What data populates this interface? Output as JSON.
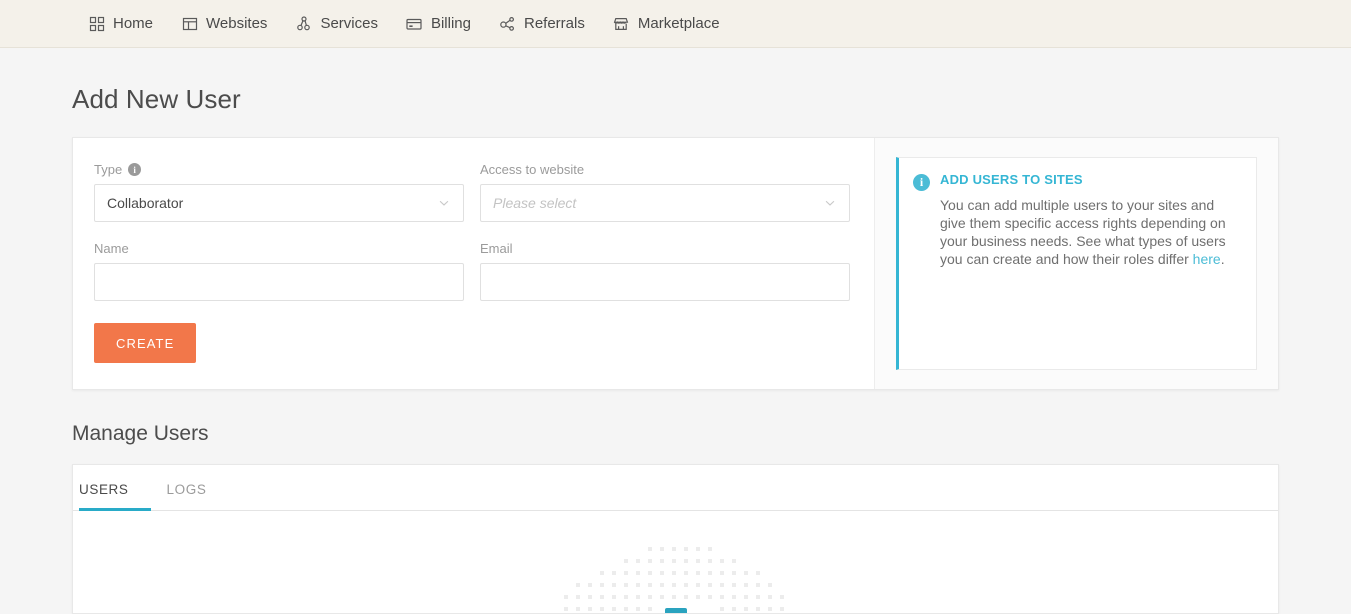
{
  "topnav": {
    "items": [
      {
        "label": "Home",
        "icon": "grid-icon"
      },
      {
        "label": "Websites",
        "icon": "browser-window-icon"
      },
      {
        "label": "Services",
        "icon": "nodes-network-icon"
      },
      {
        "label": "Billing",
        "icon": "credit-card-icon"
      },
      {
        "label": "Referrals",
        "icon": "share-nodes-icon"
      },
      {
        "label": "Marketplace",
        "icon": "storefront-icon"
      }
    ]
  },
  "page": {
    "title": "Add New User",
    "section_title": "Manage Users"
  },
  "form": {
    "type": {
      "label": "Type",
      "value": "Collaborator",
      "info_glyph": "i"
    },
    "access": {
      "label": "Access to website",
      "placeholder": "Please select",
      "value": ""
    },
    "name": {
      "label": "Name",
      "value": "",
      "placeholder": ""
    },
    "email": {
      "label": "Email",
      "value": "",
      "placeholder": ""
    },
    "submit_label": "CREATE"
  },
  "infobox": {
    "icon_glyph": "i",
    "title": "ADD USERS TO SITES",
    "body_before_link": "You can add multiple users to your sites and give them specific access rights depending on your business needs. See what types of users you can create and how their roles differ ",
    "link_text": "here",
    "body_after_link": "."
  },
  "tabs": [
    {
      "label": "USERS",
      "active": true
    },
    {
      "label": "LOGS",
      "active": false
    }
  ],
  "colors": {
    "accent_teal": "#35b6d4",
    "tab_underline": "#29abc8",
    "button_orange": "#f2774a",
    "nav_background": "#f4f1ea",
    "page_background": "#f5f5f5",
    "dot_grey": "#ececec"
  }
}
